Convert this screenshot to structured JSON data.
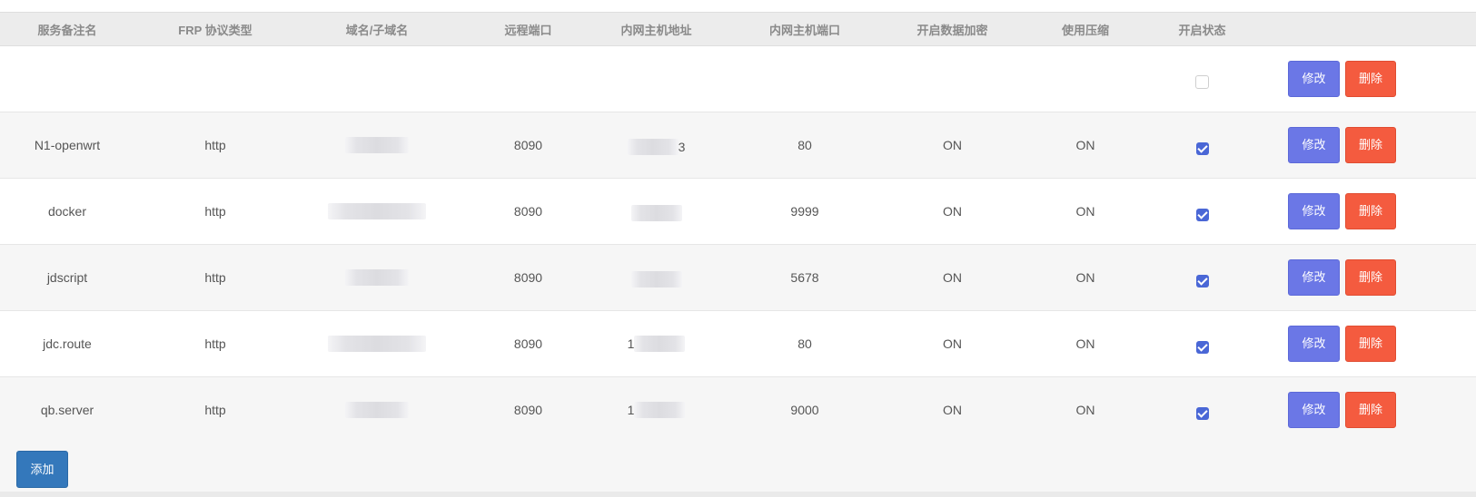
{
  "table": {
    "headers": [
      "服务备注名",
      "FRP 协议类型",
      "域名/子域名",
      "远程端口",
      "内网主机地址",
      "内网主机端口",
      "开启数据加密",
      "使用压缩",
      "开启状态",
      ""
    ],
    "rows": [
      {
        "name": "",
        "protocol": "",
        "domain": "",
        "remote_port": "",
        "local_ip_prefix": "",
        "local_ip_suffix": "",
        "local_port": "",
        "encryption": "",
        "compression": "",
        "enabled": false,
        "blurred": false
      },
      {
        "name": "N1-openwrt",
        "protocol": "http",
        "domain": "",
        "remote_port": "8090",
        "local_ip_prefix": "",
        "local_ip_suffix": "3",
        "local_port": "80",
        "encryption": "ON",
        "compression": "ON",
        "enabled": true,
        "blurred": true
      },
      {
        "name": "docker",
        "protocol": "http",
        "domain": "",
        "remote_port": "8090",
        "local_ip_prefix": "",
        "local_ip_suffix": "",
        "local_port": "9999",
        "encryption": "ON",
        "compression": "ON",
        "enabled": true,
        "blurred": true
      },
      {
        "name": "jdscript",
        "protocol": "http",
        "domain": "",
        "remote_port": "8090",
        "local_ip_prefix": "",
        "local_ip_suffix": "",
        "local_port": "5678",
        "encryption": "ON",
        "compression": "ON",
        "enabled": true,
        "blurred": true
      },
      {
        "name": "jdc.route",
        "protocol": "http",
        "domain": "",
        "remote_port": "8090",
        "local_ip_prefix": "1",
        "local_ip_suffix": "",
        "local_port": "80",
        "encryption": "ON",
        "compression": "ON",
        "enabled": true,
        "blurred": true
      },
      {
        "name": "qb.server",
        "protocol": "http",
        "domain": "",
        "remote_port": "8090",
        "local_ip_prefix": "1",
        "local_ip_suffix": "",
        "local_port": "9000",
        "encryption": "ON",
        "compression": "ON",
        "enabled": true,
        "blurred": true
      }
    ],
    "edit_label": "修改",
    "delete_label": "删除"
  },
  "footer": {
    "add_label": "添加"
  },
  "colors": {
    "edit": "#6b77e6",
    "delete": "#f45b3f",
    "add": "#3478bb",
    "checkbox": "#4a67d6"
  }
}
